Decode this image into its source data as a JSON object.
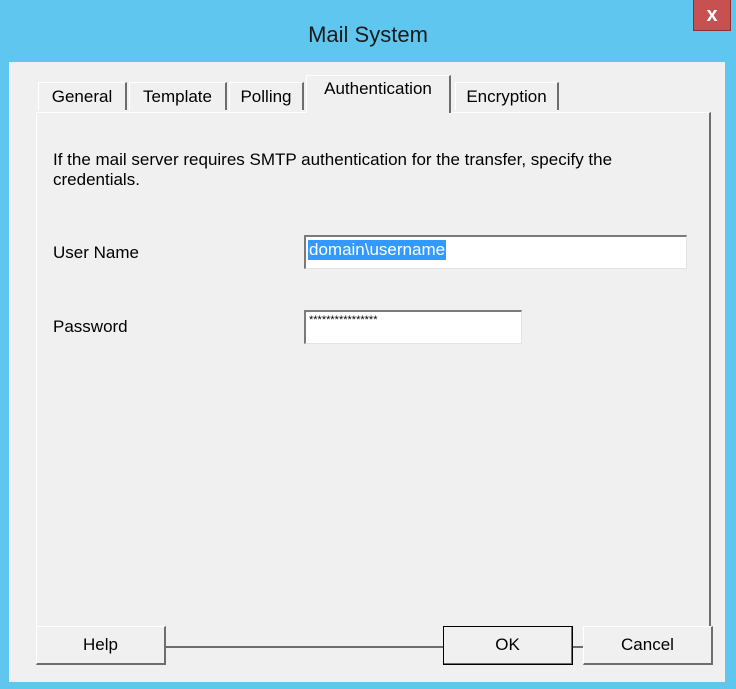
{
  "window": {
    "title": "Mail System",
    "close_label": "x"
  },
  "tabs": [
    {
      "label": "General",
      "active": false
    },
    {
      "label": "Template",
      "active": false
    },
    {
      "label": "Polling",
      "active": false
    },
    {
      "label": "Authentication",
      "active": true
    },
    {
      "label": "Encryption",
      "active": false
    }
  ],
  "authentication": {
    "description": "If the mail server requires SMTP authentication for the transfer, specify the credentials.",
    "user_name_label": "User Name",
    "user_name_value": "domain\\username",
    "password_label": "Password",
    "password_value": "****************"
  },
  "buttons": {
    "help": "Help",
    "ok": "OK",
    "cancel": "Cancel"
  },
  "colors": {
    "window_frame": "#5fc6ef",
    "dialog_face": "#f0f0f0",
    "selection": "#3399ff",
    "close_button": "#c75050"
  }
}
